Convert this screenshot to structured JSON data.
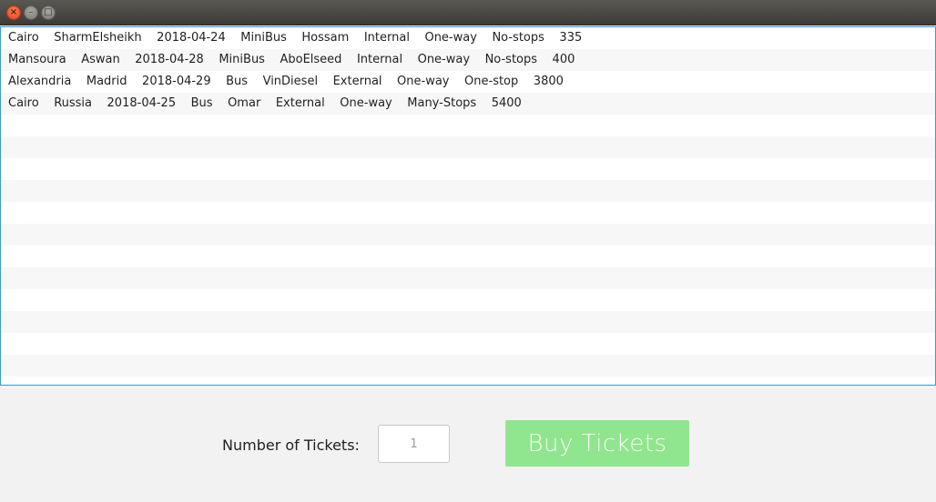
{
  "titlebar": {
    "close_glyph": "×",
    "minimize_glyph": "–",
    "maximize_glyph": "□"
  },
  "trips": [
    "Cairo    SharmElsheikh    2018-04-24    MiniBus    Hossam    Internal    One-way    No-stops    335",
    "Mansoura    Aswan    2018-04-28    MiniBus    AboElseed    Internal    One-way    No-stops    400",
    "Alexandria    Madrid    2018-04-29    Bus    VinDiesel    External    One-way    One-stop    3800",
    "Cairo    Russia    2018-04-25    Bus    Omar    External    One-way    Many-Stops    5400",
    "",
    "",
    "",
    "",
    "",
    "",
    "",
    "",
    "",
    "",
    "",
    "",
    ""
  ],
  "form": {
    "tickets_label": "Number of Tickets:",
    "tickets_value": "1",
    "buy_label": "Buy Tickets"
  },
  "colors": {
    "accent_border": "#3a9bd6",
    "buy_button_bg": "#90e68e",
    "close_button": "#e1431c"
  }
}
